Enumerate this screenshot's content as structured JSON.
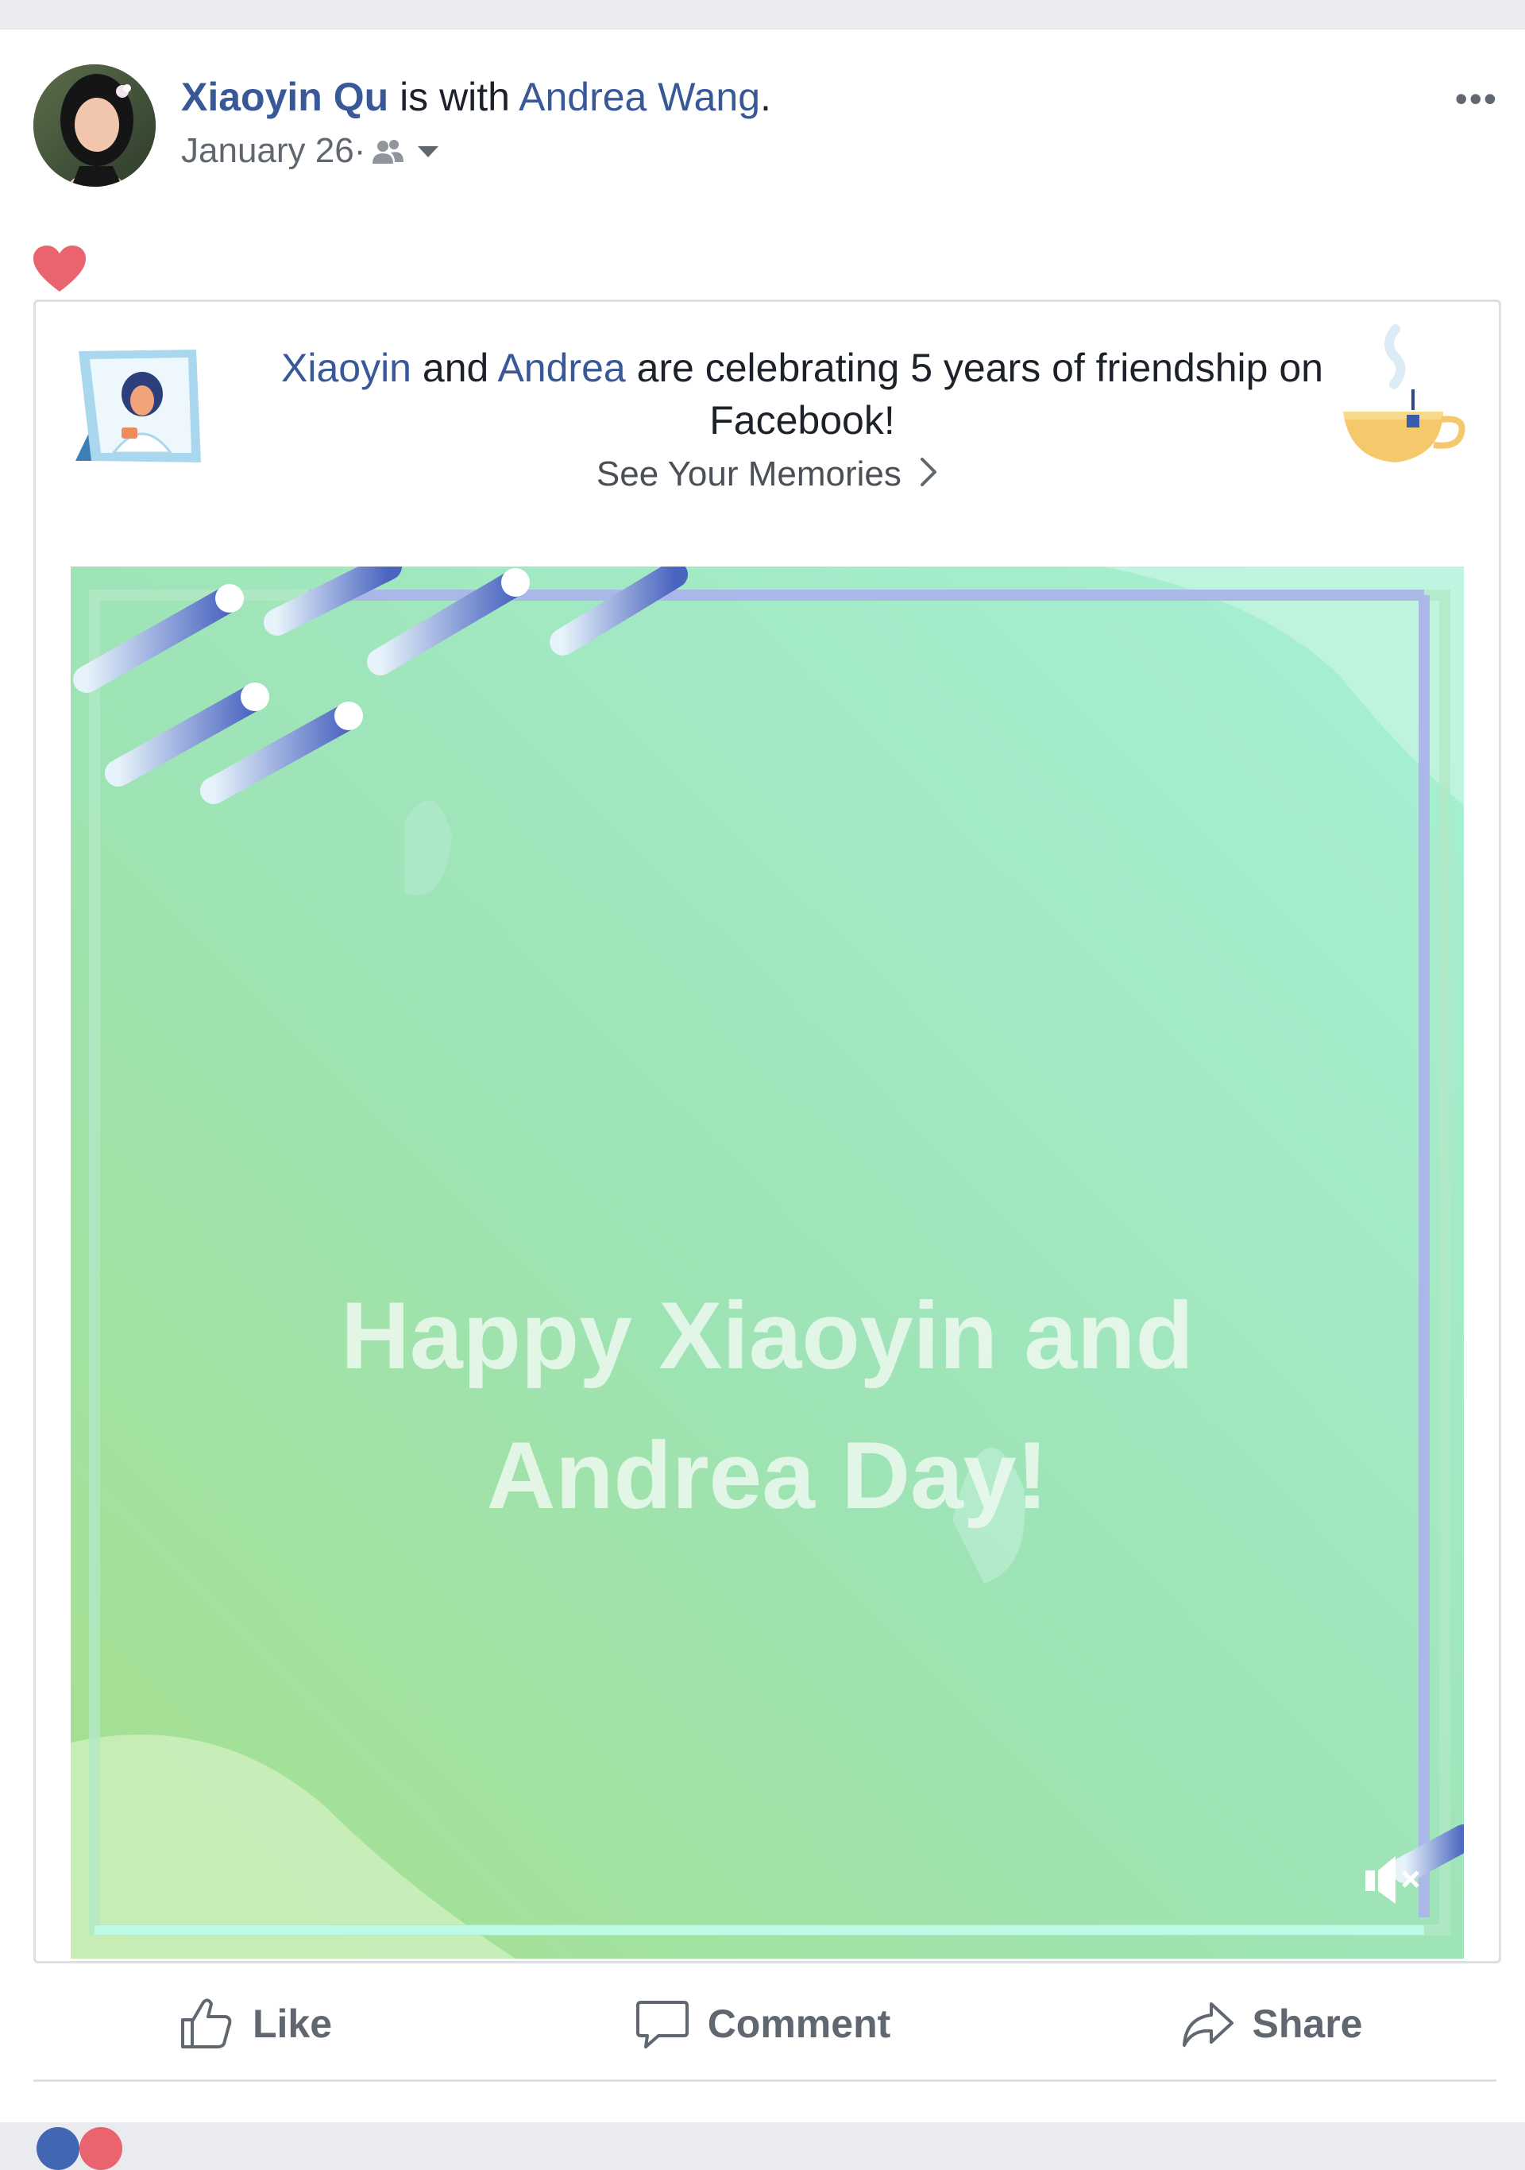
{
  "post": {
    "author": "Xiaoyin Qu",
    "with_text": " is with ",
    "tagged": "Andrea Wang",
    "period": ".",
    "date": "January 26",
    "dot": " · ",
    "more_label": "•••"
  },
  "card": {
    "name1": "Xiaoyin",
    "and": " and ",
    "name2": "Andrea",
    "rest": " are celebrating 5 years of friendship on Facebook!",
    "memories_link": "See Your Memories"
  },
  "video": {
    "line1": "Happy Xiaoyin and",
    "line2": "Andrea Day!"
  },
  "actions": {
    "like": "Like",
    "comment": "Comment",
    "share": "Share"
  },
  "colors": {
    "link": "#385898",
    "heart": "#e9646f",
    "video_bg": "#9de6c0"
  }
}
